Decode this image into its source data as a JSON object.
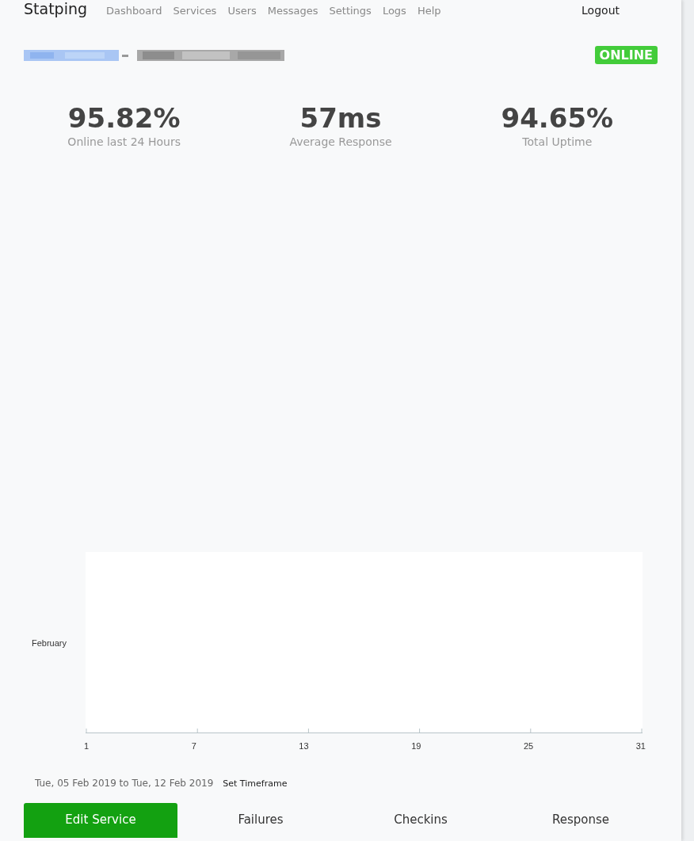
{
  "navbar": {
    "brand": "Statping",
    "links": [
      "Dashboard",
      "Services",
      "Users",
      "Messages",
      "Settings",
      "Logs",
      "Help"
    ],
    "logout": "Logout"
  },
  "service": {
    "status": "ONLINE",
    "online": true
  },
  "stats": [
    {
      "value": "95.82%",
      "label": "Online last 24 Hours"
    },
    {
      "value": "57ms",
      "label": "Average Response"
    },
    {
      "value": "94.65%",
      "label": "Total Uptime"
    }
  ],
  "chart": {
    "row_labels": [
      "February"
    ],
    "x_ticks": [
      "1",
      "7",
      "13",
      "19",
      "25",
      "31"
    ]
  },
  "timeframe": {
    "range": "Tue, 05 Feb 2019 to Tue, 12 Feb 2019",
    "button": "Set Timeframe"
  },
  "tabs": [
    {
      "label": "Edit Service",
      "selected": true
    },
    {
      "label": "Failures",
      "selected": false
    },
    {
      "label": "Checkins",
      "selected": false
    },
    {
      "label": "Response",
      "selected": false
    }
  ]
}
